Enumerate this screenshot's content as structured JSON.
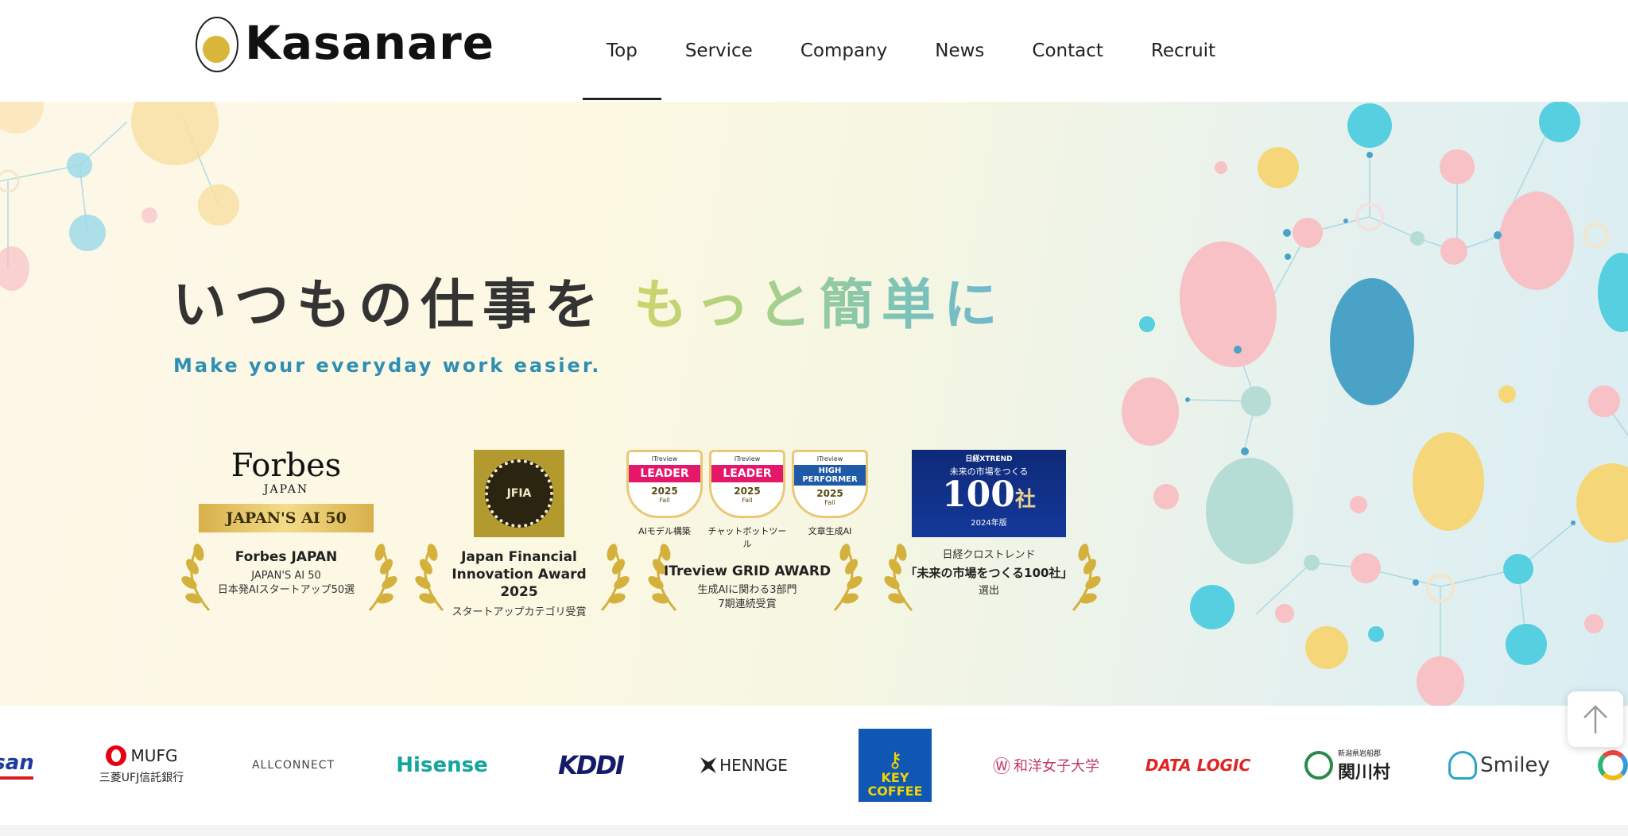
{
  "brand": {
    "name": "Kasanare"
  },
  "nav": {
    "items": [
      {
        "label": "Top",
        "active": true
      },
      {
        "label": "Service"
      },
      {
        "label": "Company"
      },
      {
        "label": "News"
      },
      {
        "label": "Contact"
      },
      {
        "label": "Recruit"
      }
    ]
  },
  "hero": {
    "headline_dark": "いつもの仕事を",
    "headline_gradient": "もっと簡単に",
    "subline": "Make your everyday work easier."
  },
  "awards": [
    {
      "badge_line1": "Forbes",
      "badge_line2": "JAPAN",
      "badge_ribbon": "JAPAN'S AI 50",
      "title": "Forbes JAPAN",
      "sub1": "JAPAN'S AI 50",
      "sub2": "日本発AIスタートアップ50選"
    },
    {
      "badge_text": "JFIA",
      "title1": "Japan Financial",
      "title2": "Innovation Award 2025",
      "sub1": "スタートアップカテゴリ受賞"
    },
    {
      "badges": [
        {
          "top": "ITreview",
          "main": "LEADER",
          "year": "2025",
          "season": "Fall",
          "caption": "AIモデル構築"
        },
        {
          "top": "ITreview",
          "main": "LEADER",
          "year": "2025",
          "season": "Fall",
          "caption": "チャットボットツール"
        },
        {
          "top": "ITreview",
          "main": "HIGH PERFORMER",
          "year": "2025",
          "season": "Fall",
          "caption": "文章生成AI"
        }
      ],
      "title": "ITreview GRID AWARD",
      "sub1": "生成AIに関わる3部門",
      "sub2": "7期連続受賞"
    },
    {
      "badge_top": "日経XTREND",
      "badge_line": "未来の市場をつくる",
      "badge_number": "100",
      "badge_unit": "社",
      "badge_year": "2024年版",
      "title": "日経クロストレンド",
      "sub1": "「未来の市場をつくる100社」",
      "sub2": "選出"
    }
  ],
  "clients": [
    "san",
    "MUFG",
    "三菱UFJ信託銀行",
    "ALLCONNECT",
    "Hisense",
    "KDDI",
    "HENNGE",
    "KEY",
    "COFFEE",
    "和洋女子大学",
    "DATA LOGIC",
    "新潟県岩船郡",
    "関川村",
    "Smiley"
  ],
  "colors": {
    "accent_blue": "#2f8fb3",
    "egg_yellow": "#f5d77a",
    "egg_pink": "#f7c1c6",
    "egg_teal": "#b5ddd5",
    "egg_cyan": "#56cfe1",
    "egg_blue": "#4aa3c6",
    "gold": "#d4b13c"
  },
  "icons": {
    "scroll_top": "arrow-up-icon"
  }
}
